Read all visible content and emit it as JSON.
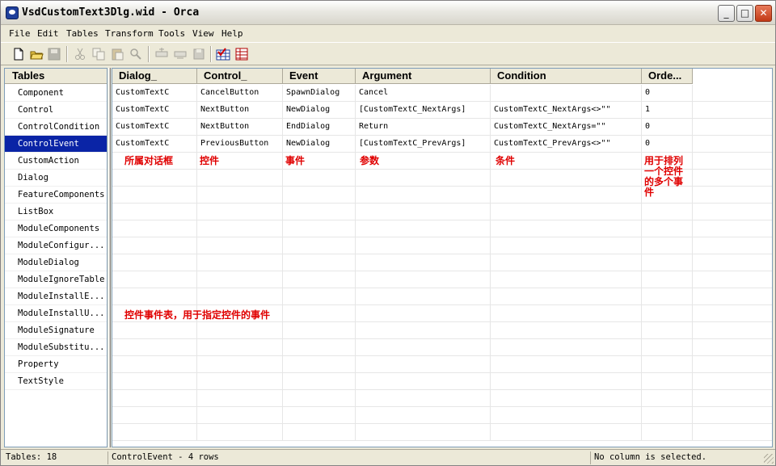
{
  "window": {
    "title": "VsdCustomText3Dlg.wid - Orca"
  },
  "titlebar_buttons": {
    "minimize": "_",
    "maximize": "□",
    "close": "✕"
  },
  "menu": [
    "File",
    "Edit",
    "Tables",
    "Transform",
    "Tools",
    "View",
    "Help"
  ],
  "toolbar": {
    "icons": [
      "new-file-icon",
      "open-folder-icon",
      "save-icon",
      "cut-icon",
      "copy-icon",
      "paste-icon",
      "find-icon",
      "add-row-icon",
      "drop-row-icon",
      "edit-icon",
      "validate-icon",
      "merge-icon"
    ]
  },
  "tables_pane": {
    "header": "Tables",
    "items": [
      "Component",
      "Control",
      "ControlCondition",
      "ControlEvent",
      "CustomAction",
      "Dialog",
      "FeatureComponents",
      "ListBox",
      "ModuleComponents",
      "ModuleConfigur...",
      "ModuleDialog",
      "ModuleIgnoreTable",
      "ModuleInstallE...",
      "ModuleInstallU...",
      "ModuleSignature",
      "ModuleSubstitu...",
      "Property",
      "TextStyle"
    ],
    "selected": "ControlEvent"
  },
  "grid": {
    "columns": [
      "Dialog_",
      "Control_",
      "Event",
      "Argument",
      "Condition",
      "Orde..."
    ],
    "rows": [
      [
        "CustomTextC",
        "CancelButton",
        "SpawnDialog",
        "Cancel",
        "",
        "0"
      ],
      [
        "CustomTextC",
        "NextButton",
        "NewDialog",
        "[CustomTextC_NextArgs]",
        "CustomTextC_NextArgs<>\"\"",
        "1"
      ],
      [
        "CustomTextC",
        "NextButton",
        "EndDialog",
        "Return",
        "CustomTextC_NextArgs=\"\"",
        "0"
      ],
      [
        "CustomTextC",
        "PreviousButton",
        "NewDialog",
        "[CustomTextC_PrevArgs]",
        "CustomTextC_PrevArgs<>\"\"",
        "0"
      ]
    ]
  },
  "annotations": {
    "dialog": "所属对话框",
    "control": "控件",
    "event": "事件",
    "argument": "参数",
    "condition": "条件",
    "order_lines": [
      "用于排列",
      "一个控件",
      "的多个事",
      "件"
    ],
    "table_desc": "控件事件表，用于指定控件的事件"
  },
  "status": {
    "tables": "Tables: 18",
    "table_info": "ControlEvent - 4 rows",
    "column_info": "No column is selected."
  }
}
